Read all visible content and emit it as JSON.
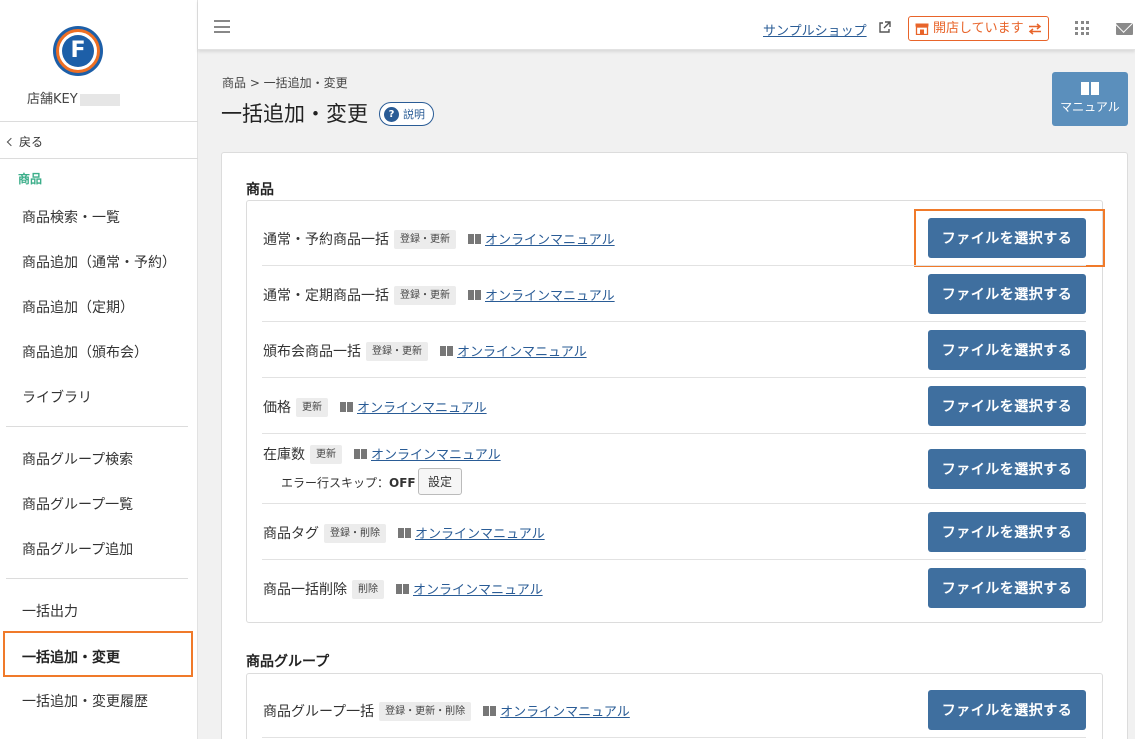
{
  "sidebar": {
    "logo_letter": "F",
    "store_name": "店舗KEY",
    "back_label": "戻る",
    "section_label": "商品",
    "items": [
      {
        "label": "商品検索・一覧"
      },
      {
        "label": "商品追加（通常・予約）"
      },
      {
        "label": "商品追加（定期）"
      },
      {
        "label": "商品追加（頒布会）"
      },
      {
        "label": "ライブラリ"
      },
      {
        "label": "商品グループ検索"
      },
      {
        "label": "商品グループ一覧"
      },
      {
        "label": "商品グループ追加"
      },
      {
        "label": "一括出力"
      },
      {
        "label": "一括追加・変更"
      },
      {
        "label": "一括追加・変更履歴"
      }
    ]
  },
  "topbar": {
    "sample_shop_label": "サンプルショップ",
    "open_status_label": "開店しています",
    "icons": [
      "menu-icon",
      "external-link-icon",
      "store-icon",
      "swap-icon",
      "apps-grid-icon",
      "mail-icon"
    ]
  },
  "header": {
    "breadcrumb": "商品 > 一括追加・変更",
    "title": "一括追加・変更",
    "help_label": "説明",
    "manual_label": "マニュアル"
  },
  "groups": [
    {
      "title": "商品",
      "rows": [
        {
          "name": "通常・予約商品一括",
          "tag": "登録・更新",
          "manual": "オンラインマニュアル",
          "button": "ファイルを選択する"
        },
        {
          "name": "通常・定期商品一括",
          "tag": "登録・更新",
          "manual": "オンラインマニュアル",
          "button": "ファイルを選択する"
        },
        {
          "name": "頒布会商品一括",
          "tag": "登録・更新",
          "manual": "オンラインマニュアル",
          "button": "ファイルを選択する"
        },
        {
          "name": "価格",
          "tag": "更新",
          "manual": "オンラインマニュアル",
          "button": "ファイルを選択する"
        },
        {
          "name": "在庫数",
          "tag": "更新",
          "manual": "オンラインマニュアル",
          "button": "ファイルを選択する",
          "skip_label": "エラー行スキップ：",
          "skip_value": "OFF",
          "setting_label": "設定"
        },
        {
          "name": "商品タグ",
          "tag": "登録・削除",
          "manual": "オンラインマニュアル",
          "button": "ファイルを選択する"
        },
        {
          "name": "商品一括削除",
          "tag": "削除",
          "manual": "オンラインマニュアル",
          "button": "ファイルを選択する"
        }
      ]
    },
    {
      "title": "商品グループ",
      "rows": [
        {
          "name": "商品グループ一括",
          "tag": "登録・更新・削除",
          "manual": "オンラインマニュアル",
          "button": "ファイルを選択する"
        }
      ]
    }
  ],
  "colors": {
    "accent_blue": "#3f6f9f",
    "link_blue": "#2a5c96",
    "highlight_orange": "#f07a2a",
    "section_green": "#3cae8a",
    "open_badge_orange": "#e8642a"
  }
}
